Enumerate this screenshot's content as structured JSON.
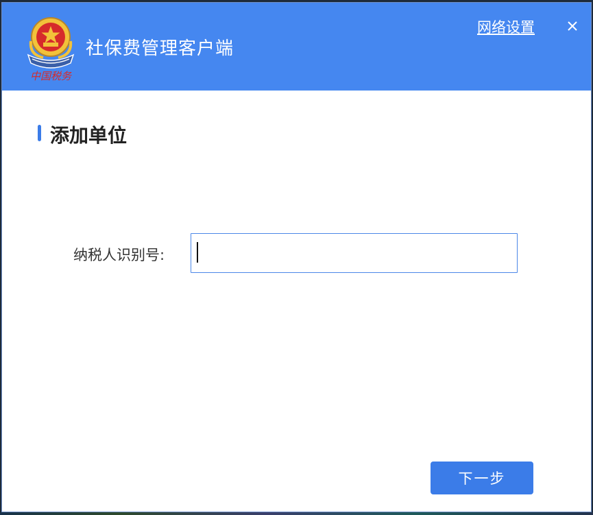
{
  "app": {
    "title": "社保费管理客户端",
    "logo_icon": "tax-emblem-icon",
    "logo_caption": "中国税务"
  },
  "header": {
    "network_settings_label": "网络设置",
    "close_icon": "close-icon"
  },
  "section": {
    "title": "添加单位"
  },
  "form": {
    "taxpayer_id_label": "纳税人识别号:",
    "taxpayer_id_value": "",
    "taxpayer_id_placeholder": ""
  },
  "actions": {
    "next_label": "下一步"
  },
  "colors": {
    "header_bg": "#4587f0",
    "accent": "#3b7ce8",
    "emblem_red": "#d62b2b",
    "emblem_gold": "#f2c23a"
  }
}
